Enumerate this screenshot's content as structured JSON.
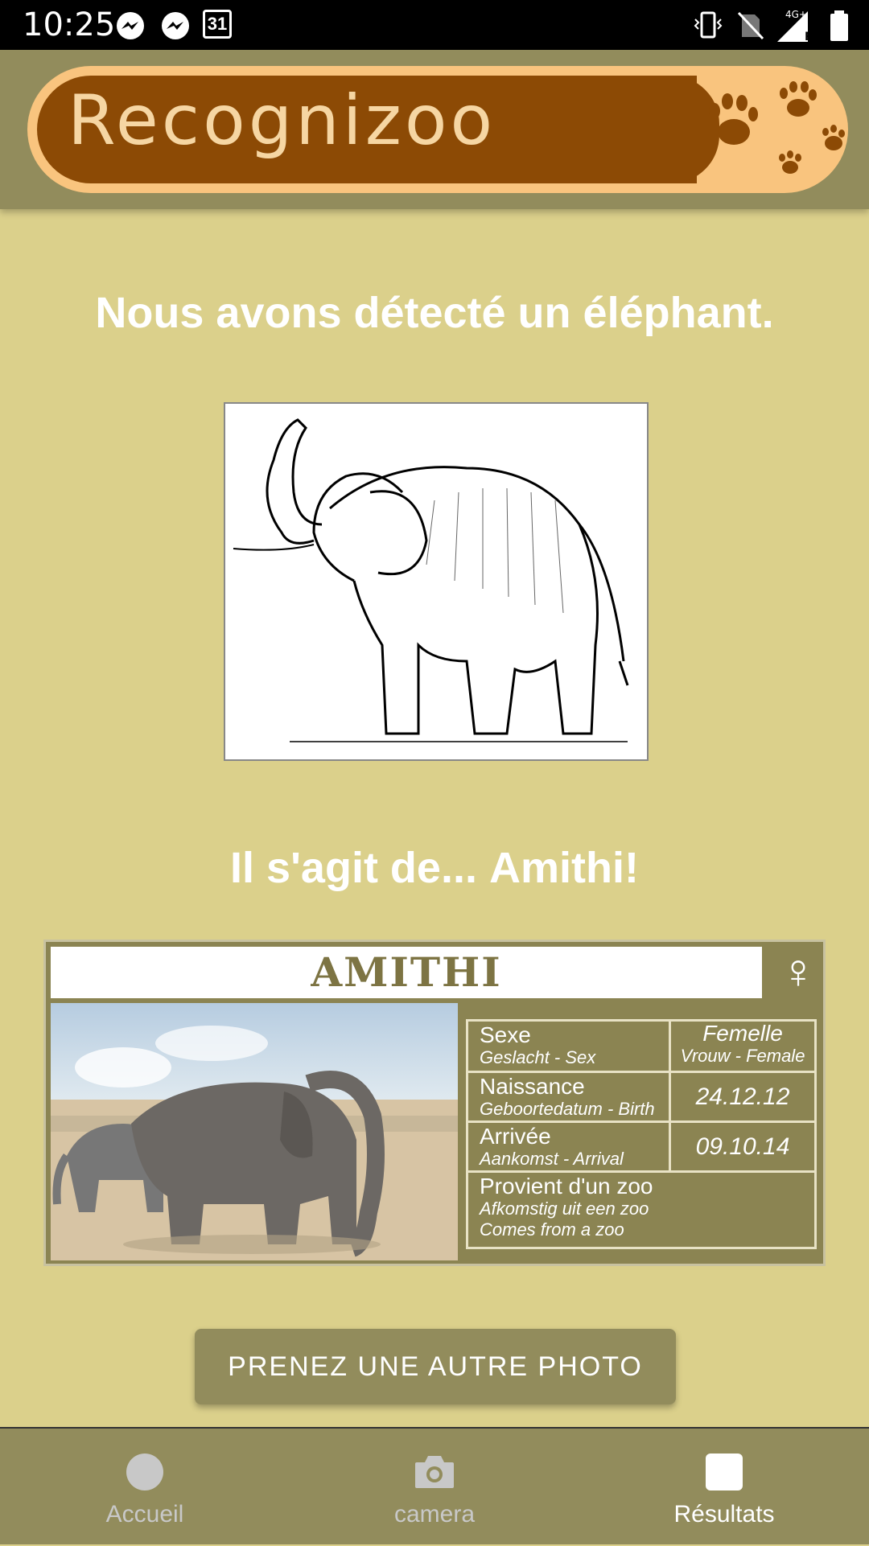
{
  "status_bar": {
    "time": "10:25",
    "icons": [
      "messenger-icon",
      "messenger-icon",
      "calendar-icon",
      "vibrate-icon",
      "no-sim-icon",
      "signal-4g-icon",
      "battery-icon"
    ],
    "calendar_day": "31",
    "network": "4G+",
    "roaming": "R"
  },
  "app_bar": {
    "logo_text": "Recognizoo"
  },
  "main": {
    "detection_text": "Nous avons détecté un éléphant.",
    "identity_prefix": "Il s'agit de... ",
    "identity_name": "Amithi!"
  },
  "card": {
    "name": "AMITHI",
    "gender_symbol": "♀",
    "rows": [
      {
        "label": "Sexe",
        "sub": "Geslacht - Sex",
        "value": "Femelle",
        "value_sub": "Vrouw - Female"
      },
      {
        "label": "Naissance",
        "sub": "Geboortedatum - Birth",
        "value": "24.12.12"
      },
      {
        "label": "Arrivée",
        "sub": "Aankomst - Arrival",
        "value": "09.10.14"
      },
      {
        "label": "Provient d'un zoo",
        "sub": "Afkomstig uit een zoo",
        "sub2": "Comes from a zoo"
      }
    ]
  },
  "action_button": {
    "label": "PRENEZ UNE AUTRE PHOTO"
  },
  "bottom_nav": {
    "items": [
      {
        "label": "Accueil",
        "icon": "circle-icon",
        "active": false
      },
      {
        "label": "camera",
        "icon": "camera-icon",
        "active": false
      },
      {
        "label": "Résultats",
        "icon": "square-icon",
        "active": true
      }
    ]
  },
  "colors": {
    "background": "#dbd08b",
    "app_bar": "#928c5c",
    "logo_brown": "#8c4a05",
    "logo_orange": "#f9c47e"
  }
}
